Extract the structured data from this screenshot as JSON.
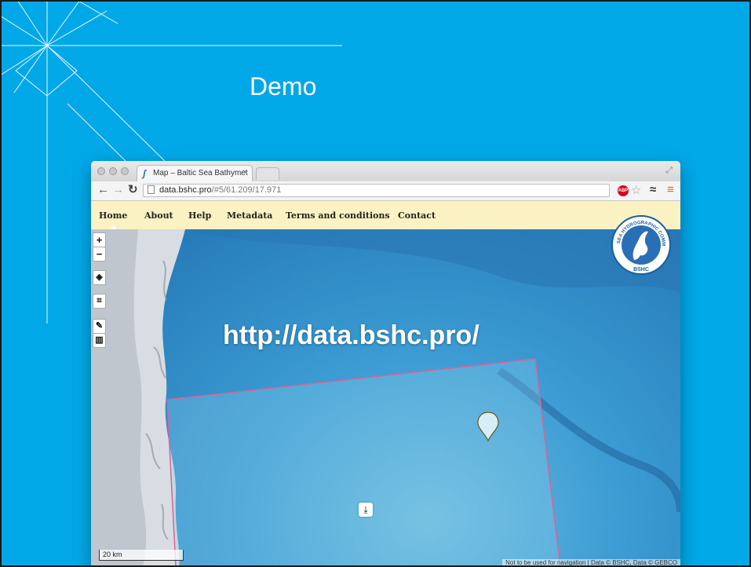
{
  "slide": {
    "title": "Demo",
    "overlay_url": "http://data.bshc.pro/"
  },
  "browser": {
    "tab_title": "Map – Baltic Sea Bathymet",
    "tab_close": "×",
    "address": {
      "domain": "data.bshc.pro",
      "path": "/#5/61.209/17.971"
    },
    "extension_badge": "ABP"
  },
  "site_nav": {
    "items": [
      {
        "label": "Home",
        "active": true
      },
      {
        "label": "About"
      },
      {
        "label": "Help"
      },
      {
        "label": "Metadata"
      },
      {
        "label": "Terms and conditions"
      },
      {
        "label": "Contact"
      }
    ]
  },
  "map": {
    "zoom_in": "+",
    "zoom_out": "−",
    "scale_label": "20 km",
    "attribution": "Not to be used for navigation | Data © BSHC, Data © GEBCO",
    "logo": {
      "text_top": "BALTIC SEA HYDROGRAPHIC COMMISSION",
      "text_bottom": "BSHC"
    },
    "colors": {
      "selection_border": "#e0609a",
      "marker": "#d8eef6"
    }
  },
  "colors": {
    "slide_background": "#00a8e8",
    "nav_background": "#fbf2c4",
    "menu_icon": "#e8650a"
  }
}
